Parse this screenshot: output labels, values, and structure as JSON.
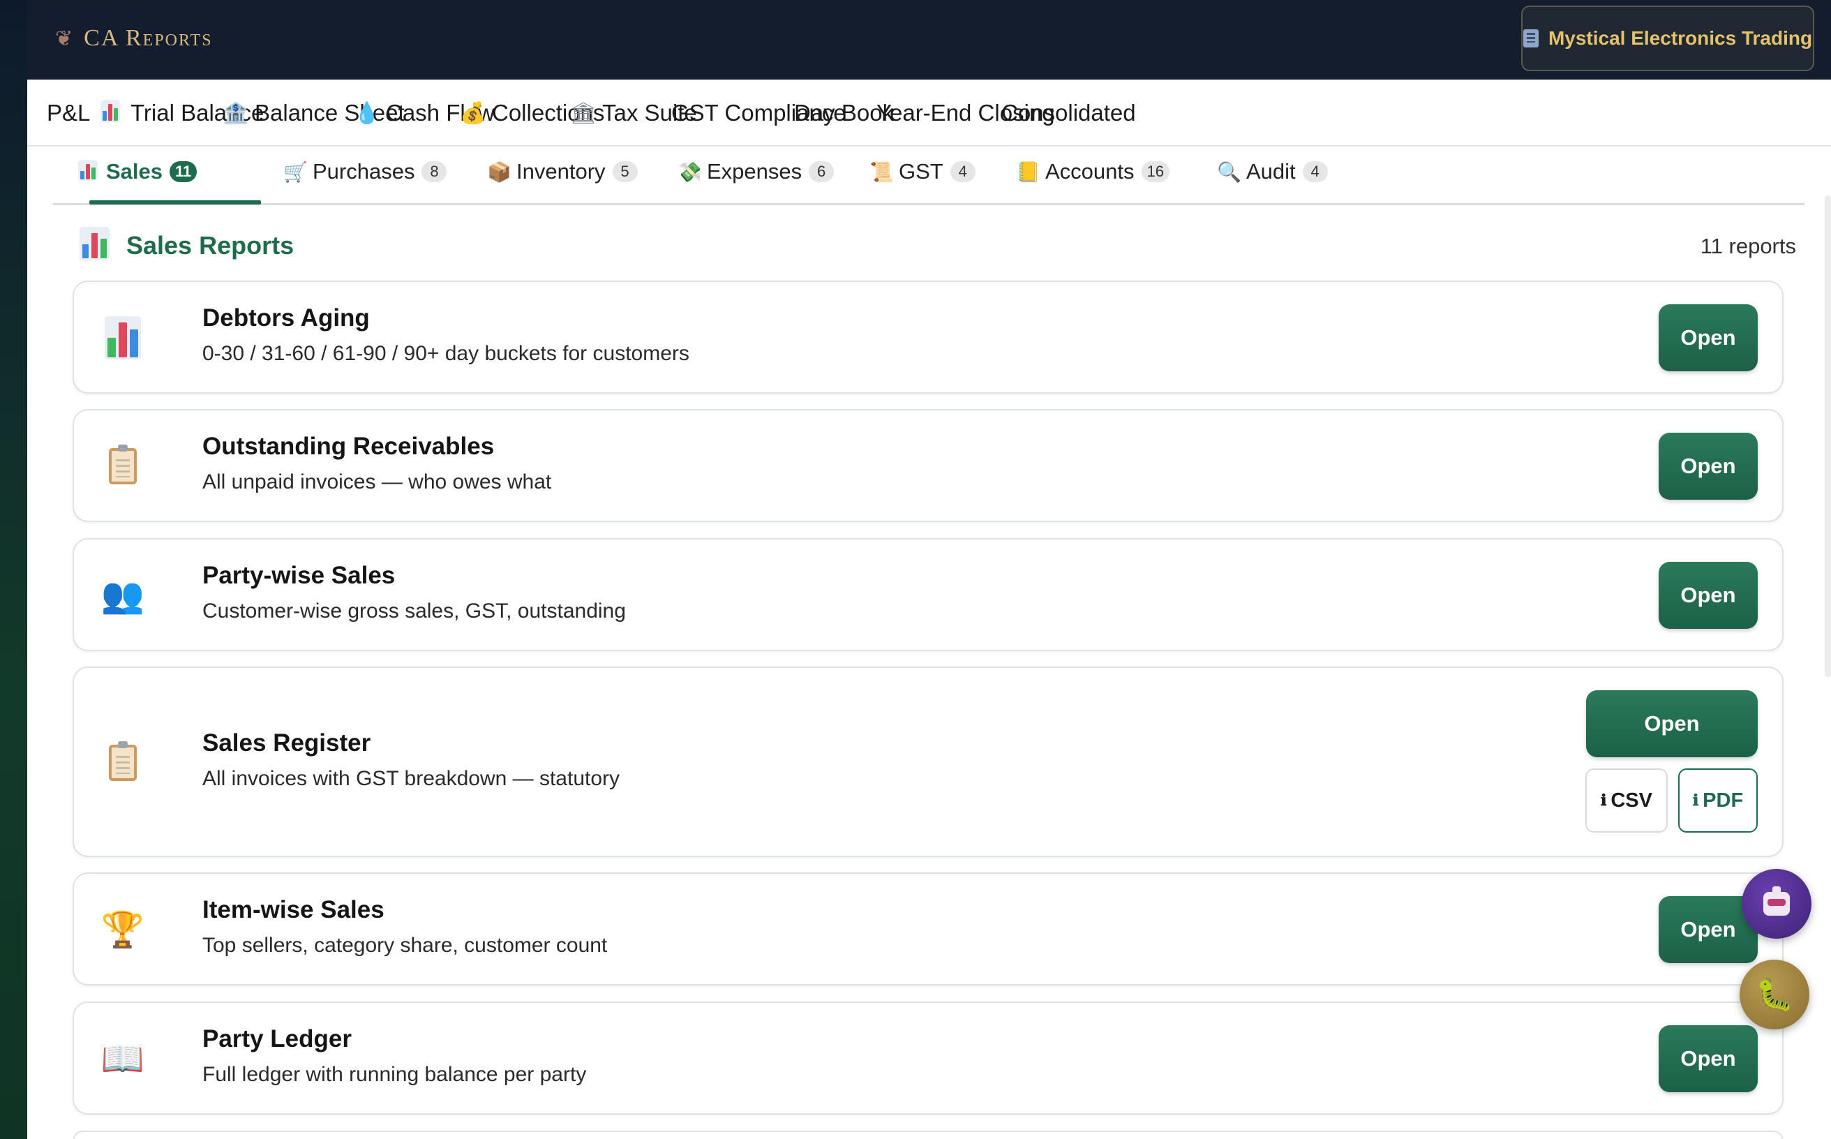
{
  "header": {
    "brand_icon": "leaf-sprout-icon",
    "brand_title": "CA Reports",
    "company_icon": "office-building-icon",
    "company_name": "Mystical Electronics Trading"
  },
  "main_nav": [
    {
      "label": "P&L",
      "icon": ""
    },
    {
      "label": "Trial Balance",
      "icon": "bar-chart-icon"
    },
    {
      "label": "Balance Sheet",
      "icon": "bank-icon"
    },
    {
      "label": "Cash Flow",
      "icon": "droplet-icon"
    },
    {
      "label": "Collections",
      "icon": "money-bag-icon"
    },
    {
      "label": "Tax Suite",
      "icon": "classical-building-icon"
    },
    {
      "label": "GST Compliance",
      "icon": ""
    },
    {
      "label": "Day Book",
      "icon": ""
    },
    {
      "label": "Year-End Closing",
      "icon": ""
    },
    {
      "label": "Consolidated",
      "icon": ""
    }
  ],
  "sub_tabs": [
    {
      "label": "Sales",
      "count": "11",
      "icon": "bar-chart-icon",
      "active": true
    },
    {
      "label": "Purchases",
      "count": "8",
      "icon": "shopping-cart-icon",
      "active": false
    },
    {
      "label": "Inventory",
      "count": "5",
      "icon": "package-icon",
      "active": false
    },
    {
      "label": "Expenses",
      "count": "6",
      "icon": "money-wings-icon",
      "active": false
    },
    {
      "label": "GST",
      "count": "4",
      "icon": "scroll-icon",
      "active": false
    },
    {
      "label": "Accounts",
      "count": "16",
      "icon": "ledger-icon",
      "active": false
    },
    {
      "label": "Audit",
      "count": "4",
      "icon": "magnifier-icon",
      "active": false
    }
  ],
  "section": {
    "title": "Sales Reports",
    "icon": "bar-chart-icon",
    "count_label": "11 reports"
  },
  "reports": [
    {
      "title": "Debtors Aging",
      "desc": "0-30 / 31-60 / 61-90 / 90+ day buckets for customers",
      "icon": "bar-chart-icon",
      "open_label": "Open"
    },
    {
      "title": "Outstanding Receivables",
      "desc": "All unpaid invoices — who owes what",
      "icon": "clipboard-icon",
      "open_label": "Open"
    },
    {
      "title": "Party-wise Sales",
      "desc": "Customer-wise gross sales, GST, outstanding",
      "icon": "people-icon",
      "open_label": "Open"
    },
    {
      "title": "Sales Register",
      "desc": "All invoices with GST breakdown — statutory",
      "icon": "clipboard-icon",
      "open_label": "Open",
      "csv_label": "CSV",
      "pdf_label": "PDF"
    },
    {
      "title": "Item-wise Sales",
      "desc": "Top sellers, category share, customer count",
      "icon": "trophy-icon",
      "open_label": "Open"
    },
    {
      "title": "Party Ledger",
      "desc": "Full ledger with running balance per party",
      "icon": "open-book-icon",
      "open_label": "Open"
    }
  ],
  "floating": {
    "assistant": "robot-icon",
    "bug_report": "bug-icon"
  },
  "colors": {
    "header_bg": "#131d2e",
    "brand_gold": "#d9b981",
    "accent_green": "#1f6b4d",
    "company_text": "#e6c26a"
  }
}
